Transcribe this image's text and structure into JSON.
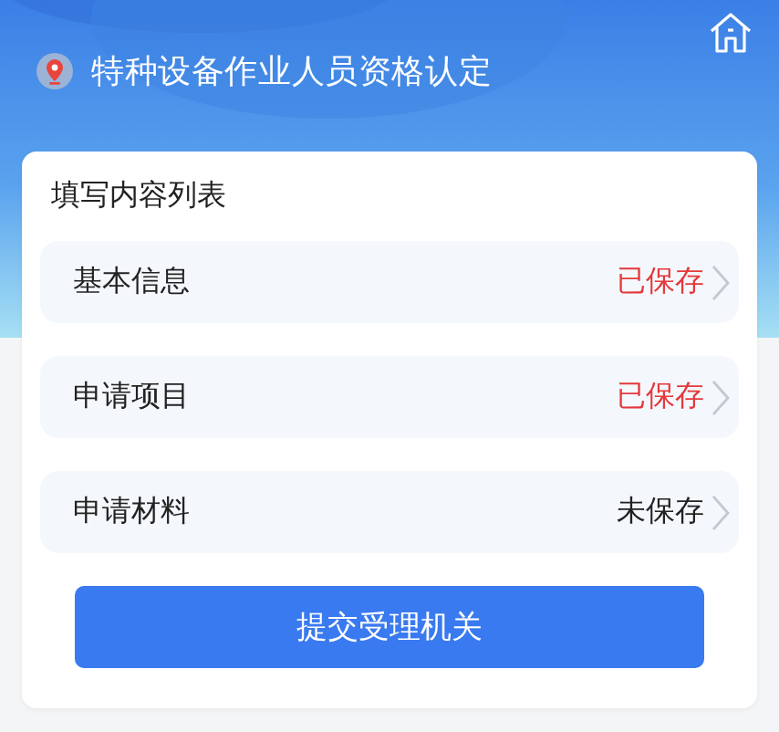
{
  "header": {
    "title": "特种设备作业人员资格认定"
  },
  "card": {
    "title": "填写内容列表",
    "items": [
      {
        "label": "基本信息",
        "status": "已保存",
        "saved": true
      },
      {
        "label": "申请项目",
        "status": "已保存",
        "saved": true
      },
      {
        "label": "申请材料",
        "status": "未保存",
        "saved": false
      }
    ],
    "submit_button": "提交受理机关"
  }
}
